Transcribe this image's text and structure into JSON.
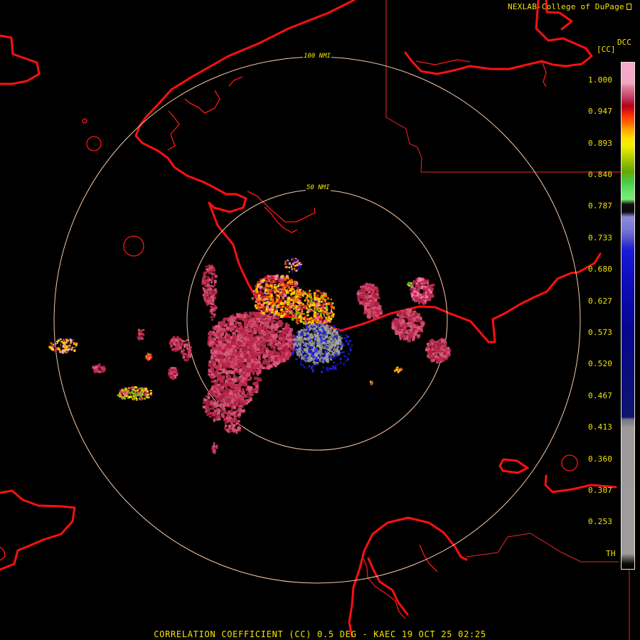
{
  "header": {
    "credit": "NEXLAB-College of DuPage",
    "credit_icon": "external-link-icon"
  },
  "legend": {
    "product_code": "DCC",
    "unit": "[CC]",
    "labels": [
      "1.000",
      "0.947",
      "0.893",
      "0.840",
      "0.787",
      "0.733",
      "0.680",
      "0.627",
      "0.573",
      "0.520",
      "0.467",
      "0.413",
      "0.360",
      "0.307",
      "0.253",
      "TH"
    ]
  },
  "range_rings": {
    "inner_label": "50 NMI",
    "outer_label": "100 NMI"
  },
  "footer": {
    "caption": "CORRELATION COEFFICIENT (CC) 0.5 DEG - KAEC 19 OCT 25 02:25"
  },
  "colors": {
    "background": "#000000",
    "text": "#f5e400",
    "range_ring": "#f7c9a8",
    "coastline": "#ff1212",
    "border": "#ff2323",
    "cc_high": "#c22d4f",
    "cc_low": "#9a9a9a",
    "cc_mid": "#1111c6"
  }
}
